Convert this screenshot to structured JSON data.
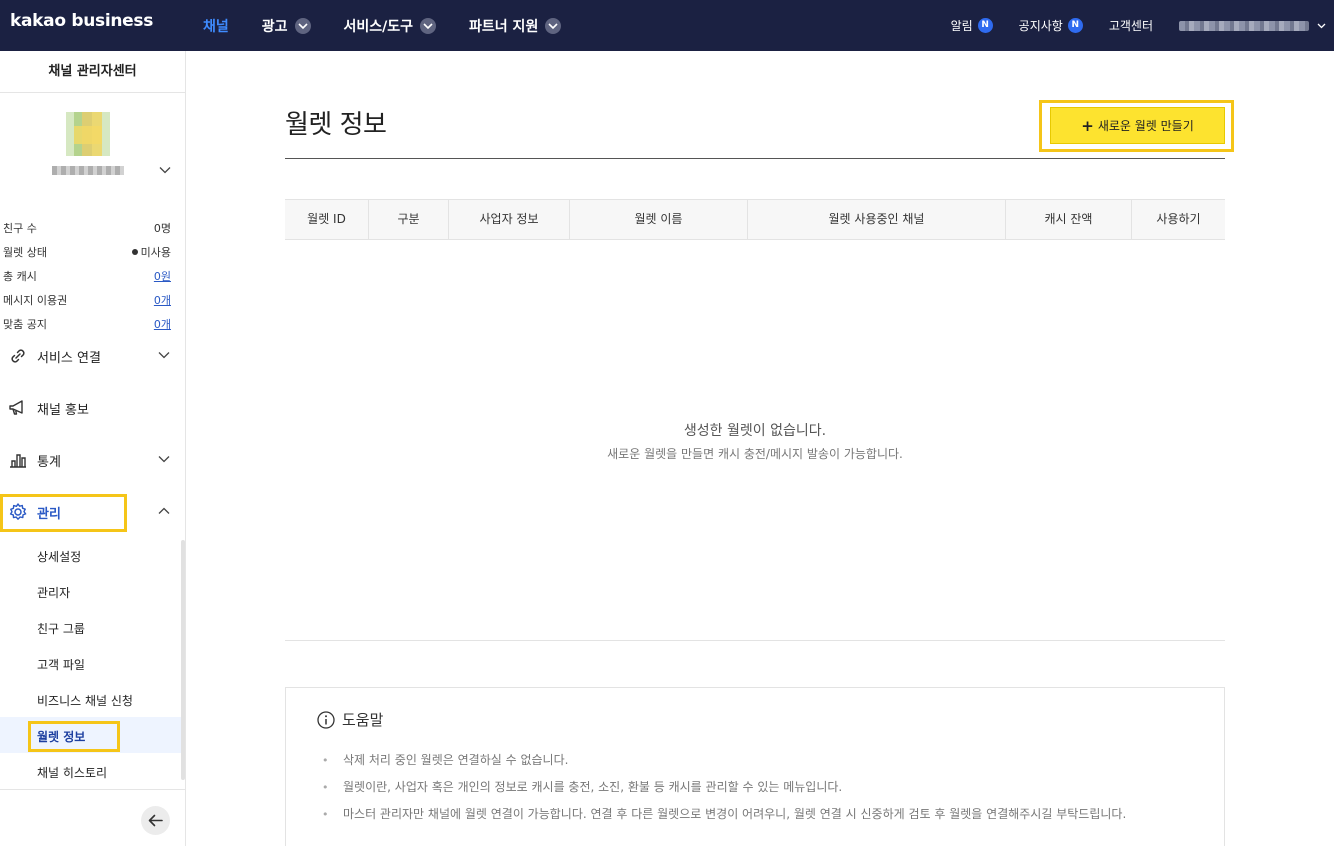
{
  "header": {
    "logo": "kakao business",
    "nav": [
      {
        "label": "채널",
        "active": true,
        "dropdown": false
      },
      {
        "label": "광고",
        "active": false,
        "dropdown": true
      },
      {
        "label": "서비스/도구",
        "active": false,
        "dropdown": true
      },
      {
        "label": "파트너 지원",
        "active": false,
        "dropdown": true
      }
    ],
    "util": {
      "alarm": "알림",
      "notice": "공지사항",
      "badge": "N",
      "support": "고객센터"
    }
  },
  "sidebar": {
    "title": "채널 관리자센터",
    "stats": [
      {
        "label": "친구 수",
        "value": "0명"
      },
      {
        "label": "월렛 상태",
        "value": "미사용"
      },
      {
        "label": "총 캐시",
        "value": "0원"
      },
      {
        "label": "메시지 이용권",
        "value": "0개"
      },
      {
        "label": "맞춤 공지",
        "value": "0개"
      }
    ],
    "menu": [
      {
        "label": "서비스 연결",
        "icon": "link-icon"
      },
      {
        "label": "채널 홍보",
        "icon": "megaphone-icon"
      },
      {
        "label": "통계",
        "icon": "bar-chart-icon"
      },
      {
        "label": "관리",
        "icon": "gear-icon"
      }
    ],
    "submenu": [
      "상세설정",
      "관리자",
      "친구 그룹",
      "고객 파일",
      "비즈니스 채널 신청",
      "월렛 정보",
      "채널 히스토리"
    ]
  },
  "main": {
    "title": "월렛 정보",
    "new_button": "새로운 월렛 만들기",
    "table_headers": [
      "월렛 ID",
      "구분",
      "사업자 정보",
      "월렛 이름",
      "월렛 사용중인 채널",
      "캐시 잔액",
      "사용하기"
    ],
    "empty_title": "생성한 월렛이 없습니다.",
    "empty_sub": "새로운 월렛을 만들면 캐시 충전/메시지 발송이 가능합니다."
  },
  "help": {
    "title": "도움말",
    "items": [
      "삭제 처리 중인 월렛은 연결하실 수 없습니다.",
      "월렛이란, 사업자 혹은 개인의 정보로 캐시를 충전, 소진, 환불 등 캐시를 관리할 수 있는 메뉴입니다.",
      "마스터 관리자만 채널에 월렛 연결이 가능합니다. 연결 후 다른 월렛으로 변경이 어려우니, 월렛 연결 시 신중하게 검토 후 월렛을 연결해주시길 부탁드립니다."
    ]
  },
  "colors": {
    "topbar": "#1b2142",
    "active_nav": "#3f8cff",
    "primary_button": "#fde32f",
    "highlight": "#f5c518",
    "link": "#2a59c5"
  }
}
